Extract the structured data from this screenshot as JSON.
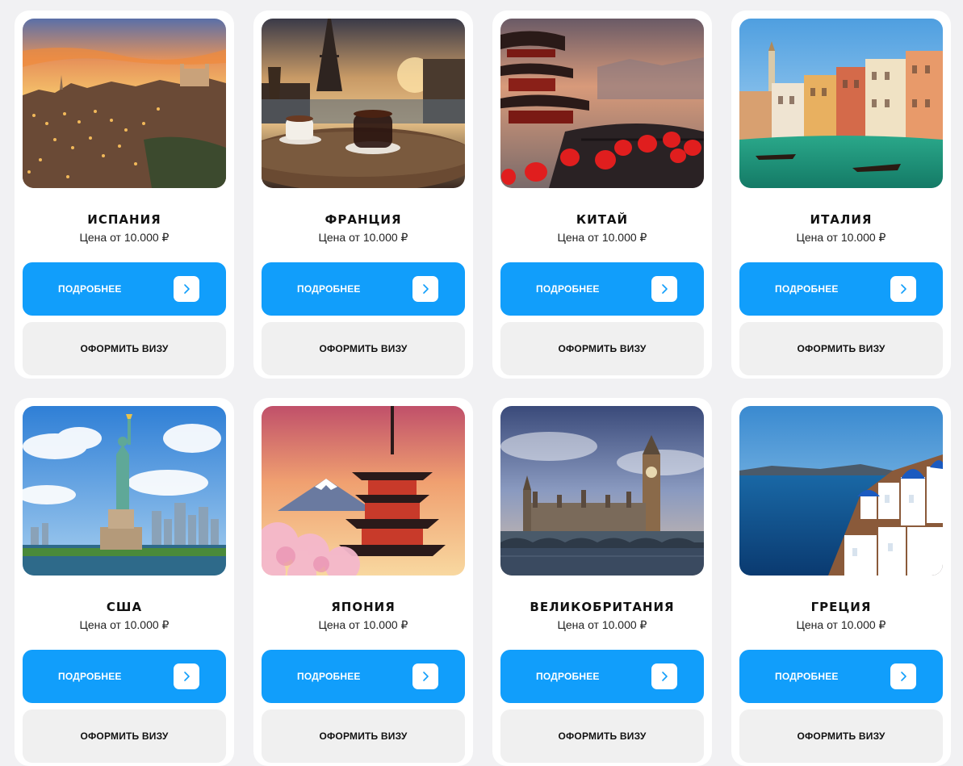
{
  "cards": [
    {
      "title": "ИСПАНИЯ",
      "price": "Цена от 10.000 ₽",
      "more": "ПОДРОБНЕЕ",
      "visa": "ОФОРМИТЬ ВИЗУ"
    },
    {
      "title": "ФРАНЦИЯ",
      "price": "Цена от 10.000 ₽",
      "more": "ПОДРОБНЕЕ",
      "visa": "ОФОРМИТЬ ВИЗУ"
    },
    {
      "title": "КИТАЙ",
      "price": "Цена от 10.000 ₽",
      "more": "ПОДРОБНЕЕ",
      "visa": "ОФОРМИТЬ ВИЗУ"
    },
    {
      "title": "ИТАЛИЯ",
      "price": "Цена от 10.000 ₽",
      "more": "ПОДРОБНЕЕ",
      "visa": "ОФОРМИТЬ ВИЗУ"
    },
    {
      "title": "США",
      "price": "Цена от 10.000 ₽",
      "more": "ПОДРОБНЕЕ",
      "visa": "ОФОРМИТЬ ВИЗУ"
    },
    {
      "title": "ЯПОНИЯ",
      "price": "Цена от 10.000 ₽",
      "more": "ПОДРОБНЕЕ",
      "visa": "ОФОРМИТЬ ВИЗУ"
    },
    {
      "title": "ВЕЛИКОБРИТАНИЯ",
      "price": "Цена от 10.000 ₽",
      "more": "ПОДРОБНЕЕ",
      "visa": "ОФОРМИТЬ ВИЗУ"
    },
    {
      "title": "ГРЕЦИЯ",
      "price": "Цена от 10.000 ₽",
      "more": "ПОДРОБНЕЕ",
      "visa": "ОФОРМИТЬ ВИЗУ"
    }
  ],
  "colors": {
    "accent": "#119efb",
    "secondary_button": "#f0f0f0",
    "page_background": "#f1f1f3",
    "card_background": "#ffffff"
  },
  "icons": {
    "more_button_icon": "chevron-right-icon"
  }
}
